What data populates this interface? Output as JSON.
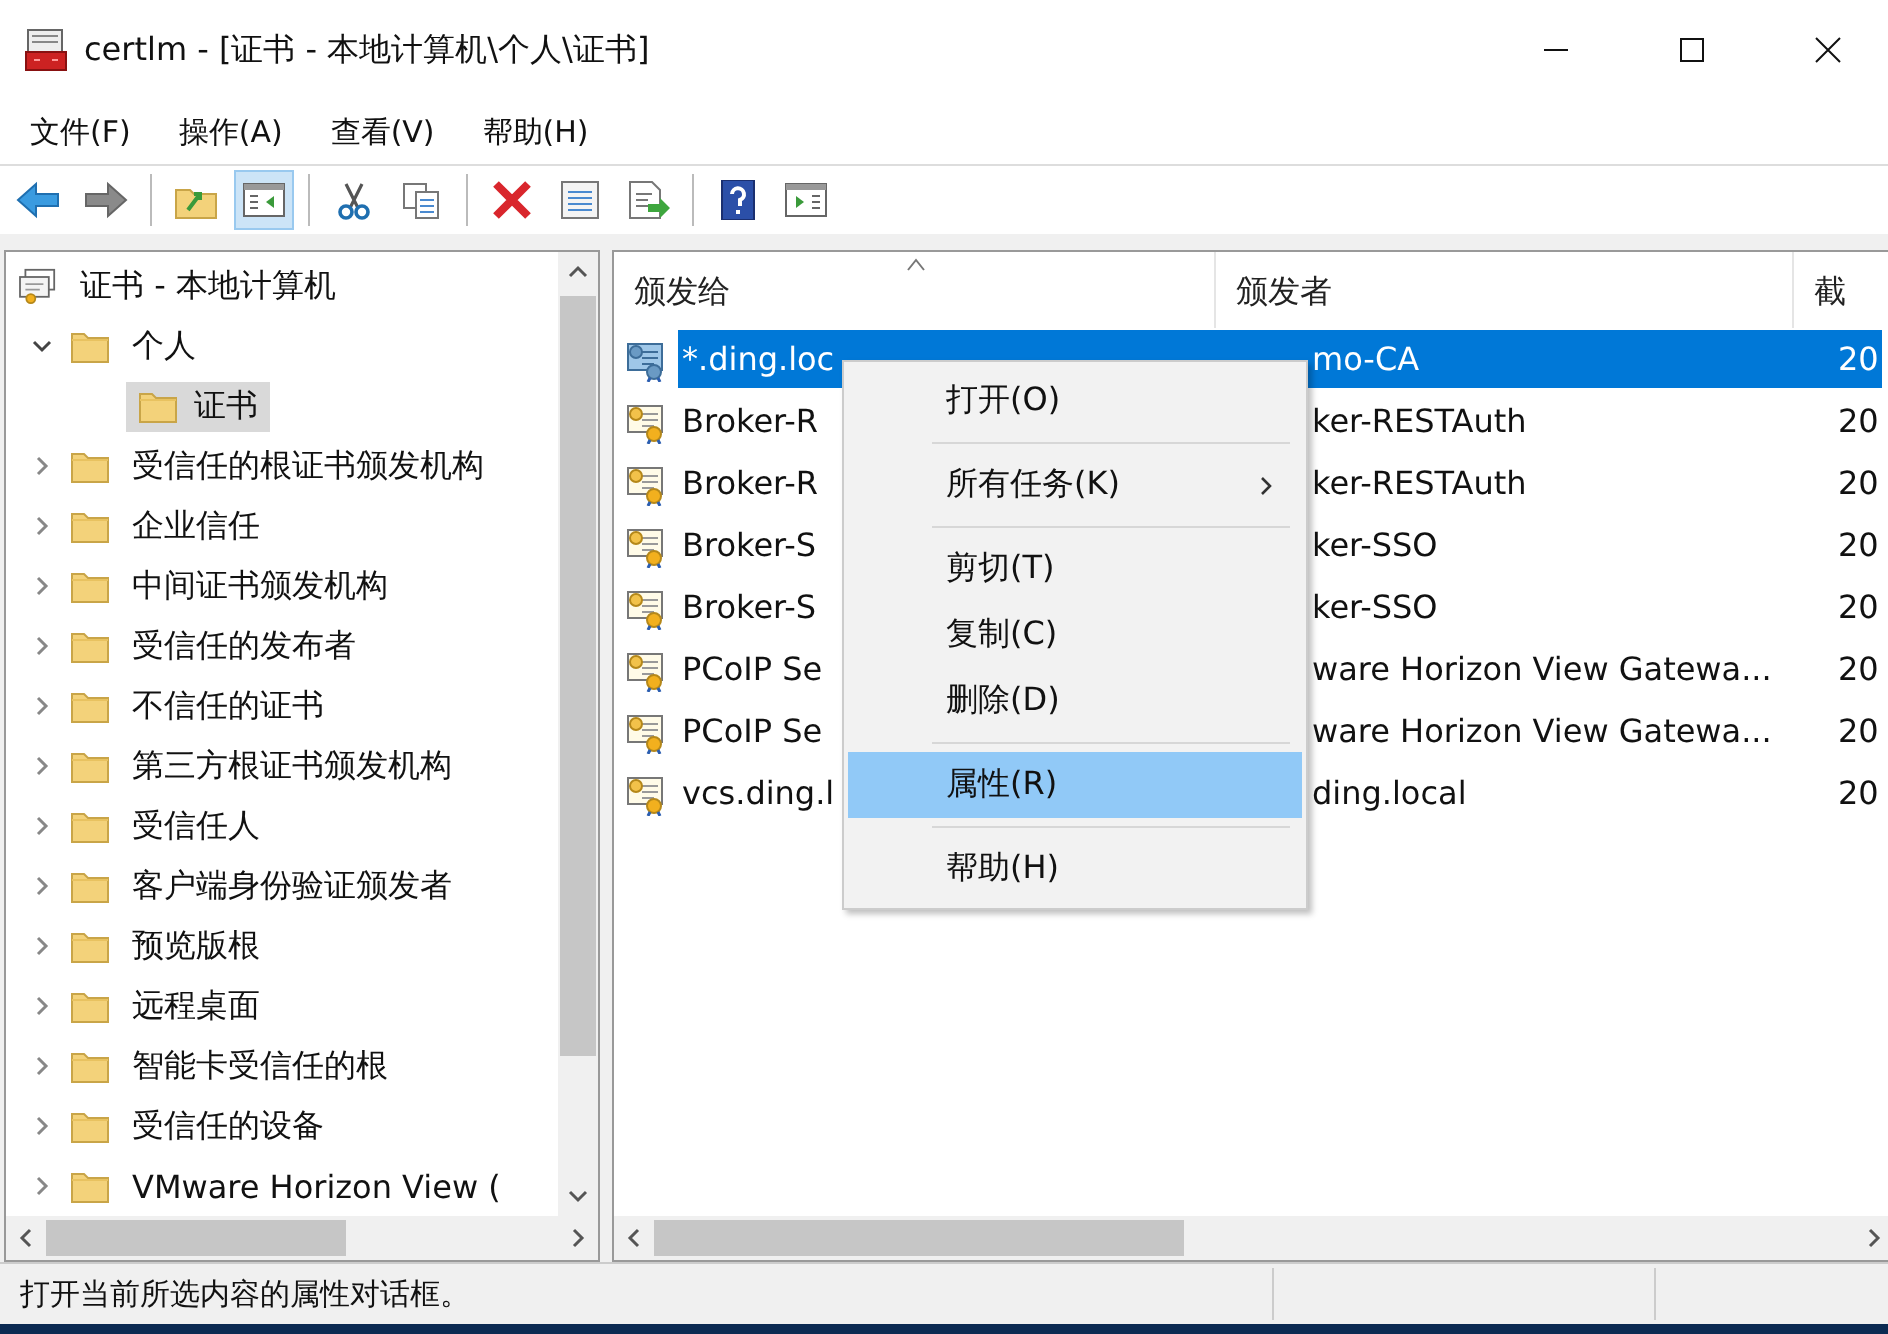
{
  "window": {
    "title": "certlm - [证书 - 本地计算机\\个人\\证书]"
  },
  "menu_bar": [
    "文件(F)",
    "操作(A)",
    "查看(V)",
    "帮助(H)"
  ],
  "toolbar": [
    {
      "kind": "back"
    },
    {
      "kind": "forward"
    },
    {
      "kind": "separator"
    },
    {
      "kind": "up"
    },
    {
      "kind": "tree",
      "pressed": true
    },
    {
      "kind": "separator"
    },
    {
      "kind": "cut"
    },
    {
      "kind": "copy"
    },
    {
      "kind": "separator"
    },
    {
      "kind": "delete"
    },
    {
      "kind": "properties"
    },
    {
      "kind": "export"
    },
    {
      "kind": "separator"
    },
    {
      "kind": "help"
    },
    {
      "kind": "pane"
    }
  ],
  "tree": {
    "label": "证书 - 本地计算机",
    "selected": false,
    "children": [
      {
        "label": "个人",
        "expanded": true,
        "selected": false,
        "children": [
          {
            "label": "证书",
            "selected": true
          }
        ]
      },
      {
        "label": "受信任的根证书颁发机构",
        "expanded": false,
        "selected": false
      },
      {
        "label": "企业信任",
        "expanded": false,
        "selected": false
      },
      {
        "label": "中间证书颁发机构",
        "expanded": false,
        "selected": false
      },
      {
        "label": "受信任的发布者",
        "expanded": false,
        "selected": false
      },
      {
        "label": "不信任的证书",
        "expanded": false,
        "selected": false
      },
      {
        "label": "第三方根证书颁发机构",
        "expanded": false,
        "selected": false
      },
      {
        "label": "受信任人",
        "expanded": false,
        "selected": false
      },
      {
        "label": "客户端身份验证颁发者",
        "expanded": false,
        "selected": false
      },
      {
        "label": "预览版根",
        "expanded": false,
        "selected": false
      },
      {
        "label": "远程桌面",
        "expanded": false,
        "selected": false
      },
      {
        "label": "智能卡受信任的根",
        "expanded": false,
        "selected": false
      },
      {
        "label": "受信任的设备",
        "expanded": false,
        "selected": false
      },
      {
        "label": "VMware Horizon View (",
        "expanded": false,
        "selected": false
      }
    ]
  },
  "table": {
    "columns": [
      {
        "label": "颁发给",
        "sorted": true
      },
      {
        "label": "颁发者",
        "sorted": false
      },
      {
        "label": "截",
        "sorted": false
      }
    ],
    "rows": [
      {
        "cells": [
          "*.ding.loc",
          "mo-CA",
          "20"
        ],
        "selected": true
      },
      {
        "cells": [
          "Broker-R",
          "ker-RESTAuth",
          "20"
        ],
        "selected": false
      },
      {
        "cells": [
          "Broker-R",
          "ker-RESTAuth",
          "20"
        ],
        "selected": false
      },
      {
        "cells": [
          "Broker-S",
          "ker-SSO",
          "20"
        ],
        "selected": false
      },
      {
        "cells": [
          "Broker-S",
          "ker-SSO",
          "20"
        ],
        "selected": false
      },
      {
        "cells": [
          "PCoIP Se",
          "ware Horizon View Gatewa...",
          "20"
        ],
        "selected": false
      },
      {
        "cells": [
          "PCoIP Se",
          "ware Horizon View Gatewa...",
          "20"
        ],
        "selected": false
      },
      {
        "cells": [
          "vcs.ding.l",
          "ding.local",
          "20"
        ],
        "selected": false
      }
    ]
  },
  "context_menu": [
    {
      "kind": "item",
      "label": "打开(O)",
      "submenu": false,
      "selected": false
    },
    {
      "kind": "separator"
    },
    {
      "kind": "item",
      "label": "所有任务(K)",
      "submenu": true,
      "selected": false
    },
    {
      "kind": "separator"
    },
    {
      "kind": "item",
      "label": "剪切(T)",
      "submenu": false,
      "selected": false
    },
    {
      "kind": "item",
      "label": "复制(C)",
      "submenu": false,
      "selected": false
    },
    {
      "kind": "item",
      "label": "删除(D)",
      "submenu": false,
      "selected": false
    },
    {
      "kind": "separator"
    },
    {
      "kind": "item",
      "label": "属性(R)",
      "submenu": false,
      "selected": true
    },
    {
      "kind": "separator"
    },
    {
      "kind": "item",
      "label": "帮助(H)",
      "submenu": false,
      "selected": false
    }
  ],
  "status_bar": "打开当前所选内容的属性对话框。"
}
